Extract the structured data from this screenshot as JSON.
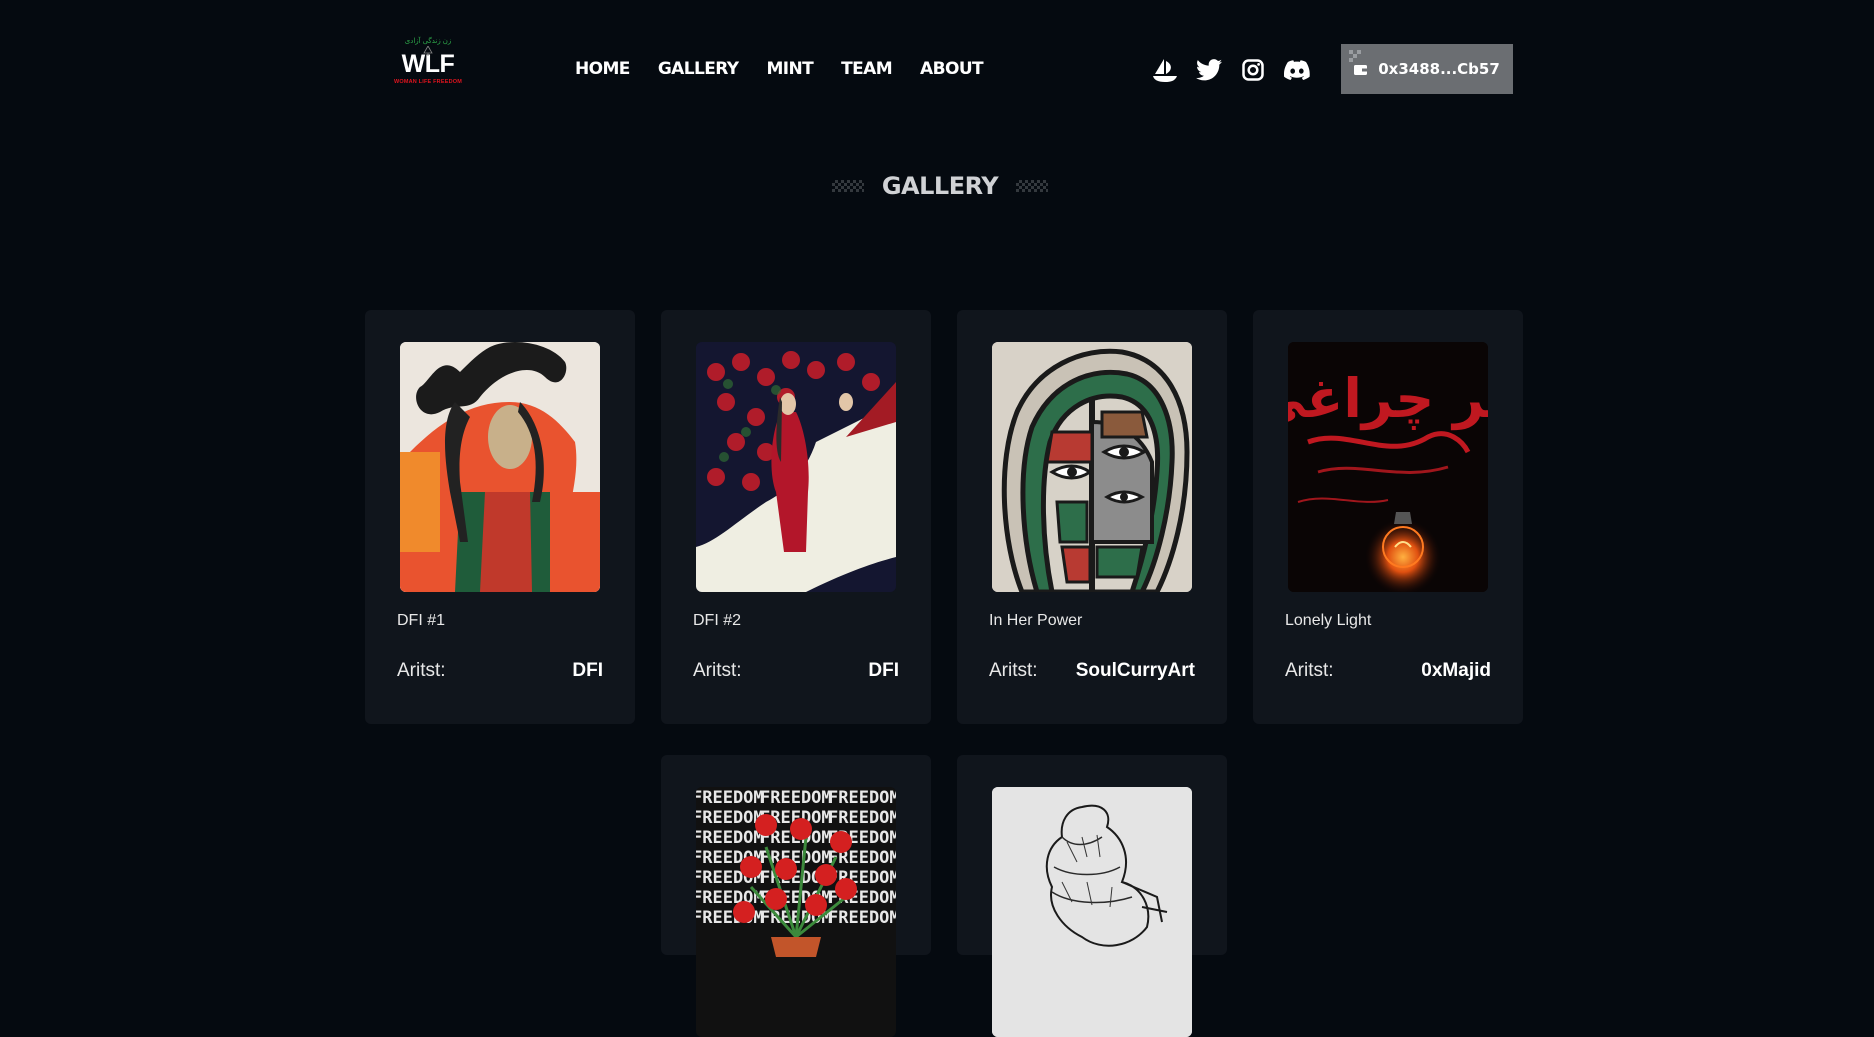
{
  "header": {
    "logo": {
      "script_text": "زن زندگی آزادی",
      "wordmark": "WLF",
      "tagline": "WOMAN LIFE FREEDOM"
    },
    "nav": [
      {
        "label": "HOME"
      },
      {
        "label": "GALLERY"
      },
      {
        "label": "MINT"
      },
      {
        "label": "TEAM"
      },
      {
        "label": "ABOUT"
      }
    ],
    "socials": [
      {
        "icon": "opensea-icon"
      },
      {
        "icon": "twitter-icon"
      },
      {
        "icon": "instagram-icon"
      },
      {
        "icon": "discord-icon"
      }
    ],
    "wallet": {
      "address": "0x3488...Cb57",
      "icon": "wallet-icon"
    }
  },
  "gallery": {
    "title": "GALLERY",
    "artist_label": "Aritst:",
    "items": [
      {
        "title": "DFI #1",
        "artist": "DFI"
      },
      {
        "title": "DFI #2",
        "artist": "DFI"
      },
      {
        "title": "In Her Power",
        "artist": "SoulCurryArt"
      },
      {
        "title": "Lonely Light",
        "artist": "0xMajid",
        "art_text": "هر چراغی"
      },
      {
        "title": "",
        "artist": "",
        "art_text": "FREEDOM"
      },
      {
        "title": "",
        "artist": ""
      }
    ]
  },
  "colors": {
    "background": "#050a10",
    "card": "#10151c",
    "wallet_button": "#6b6e72",
    "logo_red": "#e0141e",
    "logo_green": "#2ea84a"
  }
}
